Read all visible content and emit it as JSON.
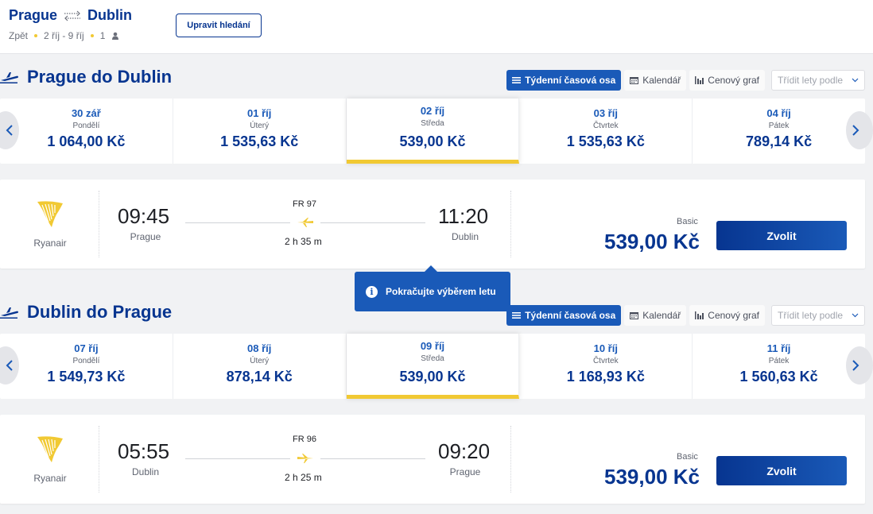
{
  "header": {
    "origin": "Prague",
    "destination": "Dublin",
    "back_label": "Zpět",
    "dates": "2 říj - 9 říj",
    "passengers": "1",
    "edit_button": "Upravit hledání"
  },
  "view_tabs": {
    "weekly": "Týdenní časová osa",
    "calendar": "Kalendář",
    "price_chart": "Cenový graf",
    "sort_placeholder": "Třídit lety podle"
  },
  "outbound": {
    "title": "Prague do Dublin",
    "dates": [
      {
        "date": "30 zář",
        "day": "Pondělí",
        "price": "1 064,00 Kč"
      },
      {
        "date": "01 říj",
        "day": "Úterý",
        "price": "1 535,63 Kč"
      },
      {
        "date": "02 říj",
        "day": "Středa",
        "price": "539,00 Kč"
      },
      {
        "date": "03 říj",
        "day": "Čtvrtek",
        "price": "1 535,63 Kč"
      },
      {
        "date": "04 říj",
        "day": "Pátek",
        "price": "789,14 Kč"
      }
    ],
    "selected_index": 2,
    "flight": {
      "airline": "Ryanair",
      "dep_time": "09:45",
      "dep_city": "Prague",
      "flight_no": "FR 97",
      "duration": "2 h 35 m",
      "arr_time": "11:20",
      "arr_city": "Dublin",
      "fare": "Basic",
      "price": "539,00 Kč",
      "select_label": "Zvolit"
    }
  },
  "tooltip": {
    "text": "Pokračujte výběrem letu"
  },
  "inbound": {
    "title": "Dublin do Prague",
    "dates": [
      {
        "date": "07 říj",
        "day": "Pondělí",
        "price": "1 549,73 Kč"
      },
      {
        "date": "08 říj",
        "day": "Úterý",
        "price": "878,14 Kč"
      },
      {
        "date": "09 říj",
        "day": "Středa",
        "price": "539,00 Kč"
      },
      {
        "date": "10 říj",
        "day": "Čtvrtek",
        "price": "1 168,93 Kč"
      },
      {
        "date": "11 říj",
        "day": "Pátek",
        "price": "1 560,63 Kč"
      }
    ],
    "selected_index": 2,
    "flight": {
      "airline": "Ryanair",
      "dep_time": "05:55",
      "dep_city": "Dublin",
      "flight_no": "FR 96",
      "duration": "2 h 25 m",
      "arr_time": "09:20",
      "arr_city": "Prague",
      "fare": "Basic",
      "price": "539,00 Kč",
      "select_label": "Zvolit"
    }
  },
  "colors": {
    "brand_navy": "#073590",
    "accent_blue": "#1a5ab8",
    "yellow": "#f1c933"
  }
}
